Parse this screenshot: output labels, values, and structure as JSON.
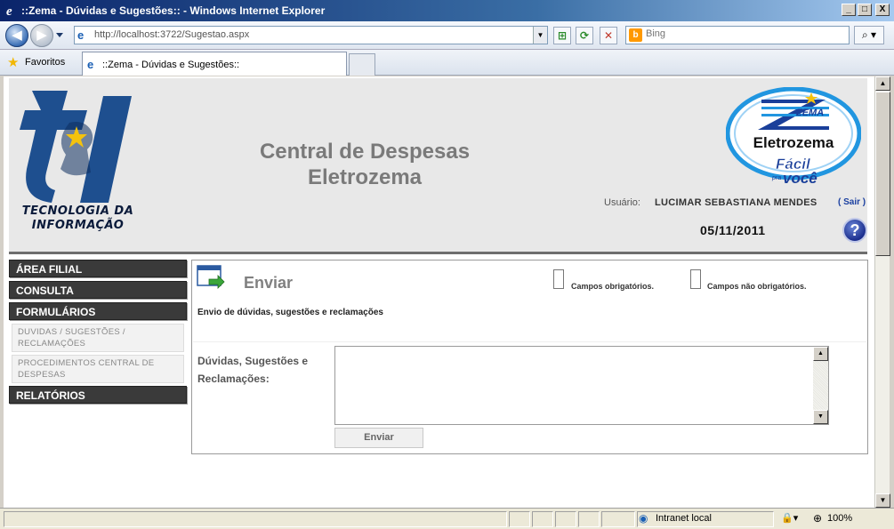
{
  "window": {
    "title": "::Zema - Dúvidas e Sugestões:: - Windows Internet Explorer",
    "controls": [
      "_",
      "□",
      "X"
    ]
  },
  "browser": {
    "url": "http://localhost:3722/Sugestao.aspx",
    "search_placeholder": "Bing",
    "favorites_label": "Favoritos",
    "tab_title": "::Zema - Dúvidas e Sugestões::",
    "status_zone": "Intranet local",
    "zoom": "100%"
  },
  "header": {
    "ti_caption_line1": "TECNOLOGIA DA",
    "ti_caption_line2": "INFORMAÇÃO",
    "app_title_line1": "Central de Despesas",
    "app_title_line2": "Eletrozema",
    "zema_logo": {
      "brand": "ZEMA",
      "name": "Eletrozema",
      "slogan_main": "Fácil",
      "slogan_small": "pra",
      "slogan_end": "você"
    },
    "user_label": "Usuário:",
    "user_name": "LUCIMAR SEBASTIANA MENDES",
    "logout_label": "( Sair )",
    "date": "05/11/2011",
    "help_label": "?"
  },
  "sidebar": {
    "sections": [
      {
        "label": "ÁREA FILIAL"
      },
      {
        "label": "CONSULTA"
      },
      {
        "label": "FORMULÁRIOS"
      },
      {
        "label": "RELATÓRIOS"
      }
    ],
    "form_items": [
      {
        "label": "DUVIDAS / SUGESTÕES / RECLAMAÇÕES"
      },
      {
        "label": "PROCEDIMENTOS CENTRAL DE DESPESAS"
      }
    ]
  },
  "form": {
    "title": "Enviar",
    "legend_required": "Campos obrigatórios.",
    "legend_optional": "Campos não obrigatórios.",
    "subtitle": "Envio de dúvidas, sugestões e reclamações",
    "field_label": "Dúvidas, Sugestões e Reclamações:",
    "field_value": "",
    "submit_label": "Enviar"
  }
}
